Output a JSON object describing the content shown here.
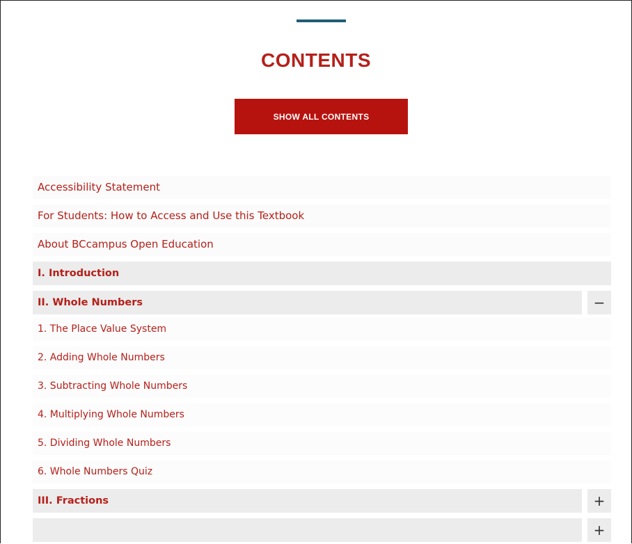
{
  "header": {
    "title": "CONTENTS",
    "show_all_label": "SHOW ALL CONTENTS"
  },
  "front_matter": [
    "Accessibility Statement",
    "For Students: How to Access and Use this Textbook",
    "About BCcampus Open Education"
  ],
  "parts": [
    {
      "title": "I. Introduction",
      "toggle": ""
    },
    {
      "title": "II. Whole Numbers",
      "toggle": "−",
      "chapters": [
        "1. The Place Value System",
        "2. Adding Whole Numbers",
        "3. Subtracting Whole Numbers",
        "4. Multiplying Whole Numbers",
        "5. Dividing Whole Numbers",
        "6. Whole Numbers Quiz"
      ]
    },
    {
      "title": "III. Fractions",
      "toggle": "+"
    },
    {
      "title": "",
      "toggle": "+"
    }
  ],
  "colors": {
    "accent": "#b5201a",
    "button": "#b7130e",
    "bar": "#1e5e78",
    "row_bg": "#ececec"
  }
}
